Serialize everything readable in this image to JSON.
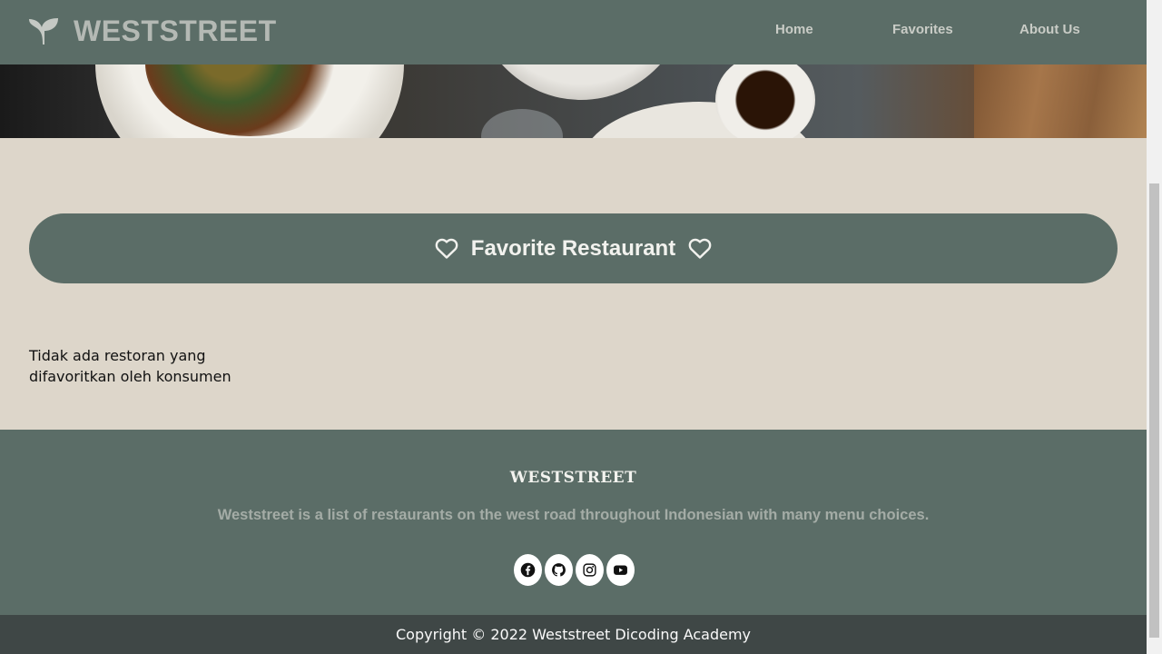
{
  "header": {
    "brand": "WESTSTREET",
    "nav": [
      {
        "label": "Home"
      },
      {
        "label": "Favorites"
      },
      {
        "label": "About Us"
      }
    ]
  },
  "main": {
    "section_title": "Favorite Restaurant",
    "empty_message": "Tidak ada restoran yang difavoritkan oleh konsumen"
  },
  "footer": {
    "brand": "WESTSTREET",
    "description": "Weststreet is a list of restaurants on the west road throughout Indonesian with many menu choices.",
    "social_icons": [
      "facebook-icon",
      "github-icon",
      "instagram-icon",
      "youtube-icon"
    ],
    "copyright": "Copyright © 2022 Weststreet Dicoding Academy"
  },
  "colors": {
    "primary": "#5b6d67",
    "background": "#ddd6ca",
    "copyright_bar": "#3f4746"
  }
}
